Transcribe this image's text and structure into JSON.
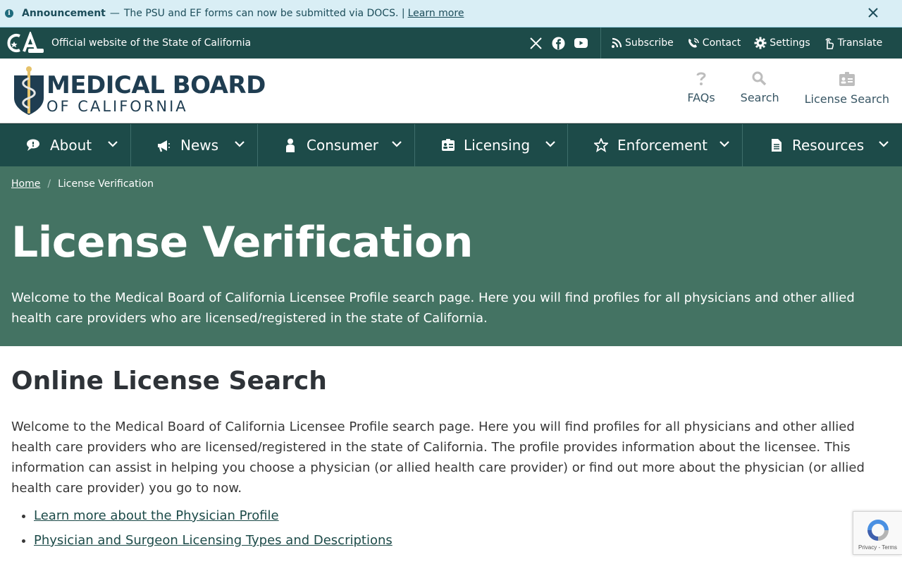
{
  "announcement": {
    "title": "Announcement",
    "dash": "—",
    "message": "The PSU and EF forms can now be submitted via DOCS. |",
    "link": "Learn more"
  },
  "statebar": {
    "official": "Official website of the State of California",
    "social": [
      "x-icon",
      "facebook-icon",
      "youtube-icon"
    ],
    "utility": [
      {
        "label": "Subscribe",
        "icon": "rss-icon"
      },
      {
        "label": "Contact",
        "icon": "phone-icon"
      },
      {
        "label": "Settings",
        "icon": "gear-icon"
      },
      {
        "label": "Translate",
        "icon": "hand-pointer-icon"
      }
    ]
  },
  "header": {
    "logo_line1": "MEDICAL BOARD",
    "logo_line2": "OF CALIFORNIA",
    "links": [
      {
        "label": "FAQs",
        "icon": "question-icon"
      },
      {
        "label": "Search",
        "icon": "search-icon"
      },
      {
        "label": "License Search",
        "icon": "id-card-icon"
      }
    ]
  },
  "nav": [
    {
      "label": "About",
      "icon": "chat-icon"
    },
    {
      "label": "News",
      "icon": "megaphone-icon"
    },
    {
      "label": "Consumer",
      "icon": "person-icon"
    },
    {
      "label": "Licensing",
      "icon": "id-badge-icon"
    },
    {
      "label": "Enforcement",
      "icon": "star-icon"
    },
    {
      "label": "Resources",
      "icon": "document-icon"
    }
  ],
  "breadcrumb": {
    "home": "Home",
    "separator": "/",
    "current": "License Verification"
  },
  "hero": {
    "title": "License Verification",
    "text": "Welcome to the Medical Board of California Licensee Profile search page. Here you will find profiles for all physicians and other allied health care providers who are licensed/registered in the state of California."
  },
  "content": {
    "heading": "Online License Search",
    "intro": "Welcome to the Medical Board of California Licensee Profile search page. Here you will find profiles for all physicians and other allied health care providers who are licensed/registered in the state of California. The profile provides information about the licensee. This information can assist in helping you choose a physician (or allied health care provider) or find out more about the physician (or allied health care provider) you go to now.",
    "links": [
      "Learn more about the Physician Profile",
      "Physician and Surgeon Licensing Types and Descriptions"
    ]
  },
  "recaptcha": {
    "links": "Privacy - Terms"
  },
  "colors": {
    "primary_dark": "#1d4b49",
    "hero_bg": "#447363",
    "announce_bg": "#d9eef5"
  }
}
